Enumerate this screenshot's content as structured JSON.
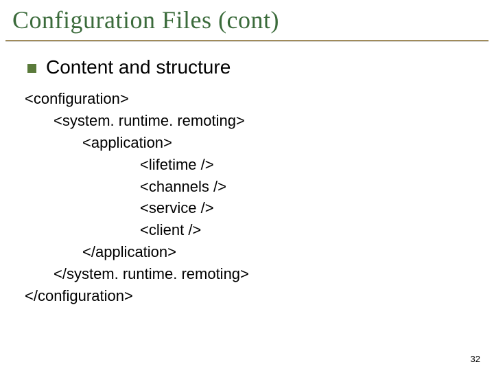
{
  "title": "Configuration Files (cont)",
  "bullet": "Content and structure",
  "code": {
    "l1": "<configuration>",
    "l2": "<system. runtime. remoting>",
    "l3": "<application>",
    "l4": "<lifetime />",
    "l5": "<channels />",
    "l6": "<service />",
    "l7": "<client />",
    "l8": "</application>",
    "l9": "</system. runtime. remoting>",
    "l10": "</configuration>"
  },
  "page_number": "32"
}
